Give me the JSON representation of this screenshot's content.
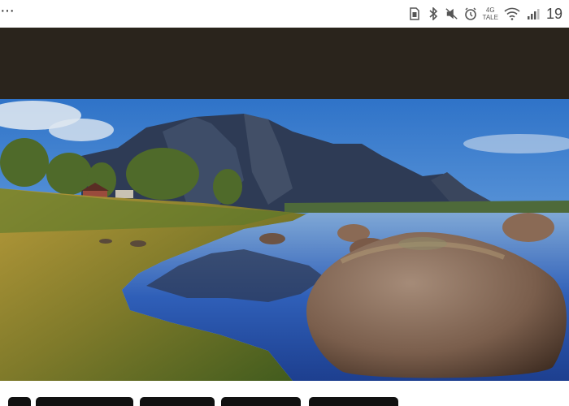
{
  "status_bar": {
    "overflow_menu": "···",
    "network_type": "4G",
    "network_sub": "TALE",
    "clock": "19",
    "icons": [
      "sim-icon",
      "bluetooth-icon",
      "mute-icon",
      "alarm-icon",
      "wifi-icon",
      "signal-icon"
    ]
  },
  "header": {
    "background_color": "#2a241c"
  },
  "hero_image": {
    "description_icon": "landscape-photo"
  }
}
